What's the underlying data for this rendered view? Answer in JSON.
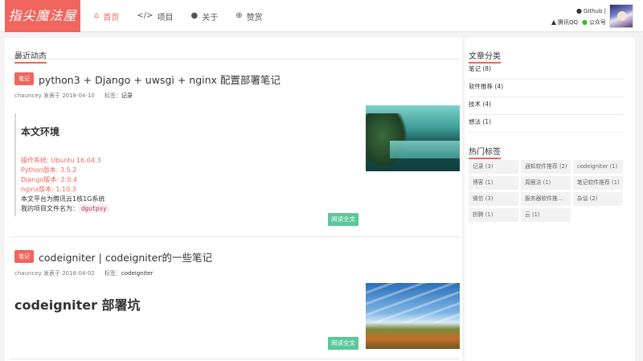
{
  "header": {
    "logo": "指尖魔法屋",
    "nav": [
      {
        "label": "首页",
        "icon": "home-icon",
        "active": true
      },
      {
        "label": "项目",
        "icon": "code-icon",
        "active": false
      },
      {
        "label": "关于",
        "icon": "user-icon",
        "active": false
      },
      {
        "label": "赞赏",
        "icon": "yen-icon",
        "active": false
      }
    ],
    "github": "Github |",
    "qq": "腾讯QQ",
    "wechat": "公众号",
    "accent": "#f0655d"
  },
  "main": {
    "recent_title": "最近动态",
    "posts": [
      {
        "tag": "笔记",
        "title": "python3 + Django + uwsgi + nginx 配置部署笔记",
        "author": "chauncey 发表于 2018-04-10",
        "tags_label": "标签：",
        "tags": "记录",
        "excerpt_heading": "本文环境",
        "lines_red": [
          "操作系统: Ubuntu 16.04.3",
          "Python版本: 3.5.2",
          "Django版本: 2.0.4",
          "nginx版本: 1.10.3"
        ],
        "line_dark": "本文平台为腾讯云1核1G系统",
        "line_code_prefix": "我的项目文件名为：",
        "line_code": "dgutpsy",
        "read_more": "阅读全文"
      },
      {
        "tag": "笔记",
        "title": "codeigniter | codeigniter的一些笔记",
        "author": "chauncey 发表于 2018-04-02",
        "tags_label": "标签：",
        "tags": "codeigniter",
        "excerpt_heading": "codeigniter 部署坑",
        "read_more": "阅读全文"
      }
    ]
  },
  "sidebar": {
    "categories_title": "文章分类",
    "categories": [
      "笔记 (8)",
      "软件推荐 (4)",
      "技术 (4)",
      "想法 (1)"
    ],
    "hot_tags_title": "热门标签",
    "hot_tags": [
      "记录 (3)",
      "通知软件推荐 (2)",
      "codeigniter (1)",
      "博客 (1)",
      "周圈法 (1)",
      "笔记软件推荐 (1)",
      "微信 (3)",
      "服务器软件推...",
      "杂谈 (2)",
      "折腾 (1)",
      "云 (1)"
    ]
  }
}
